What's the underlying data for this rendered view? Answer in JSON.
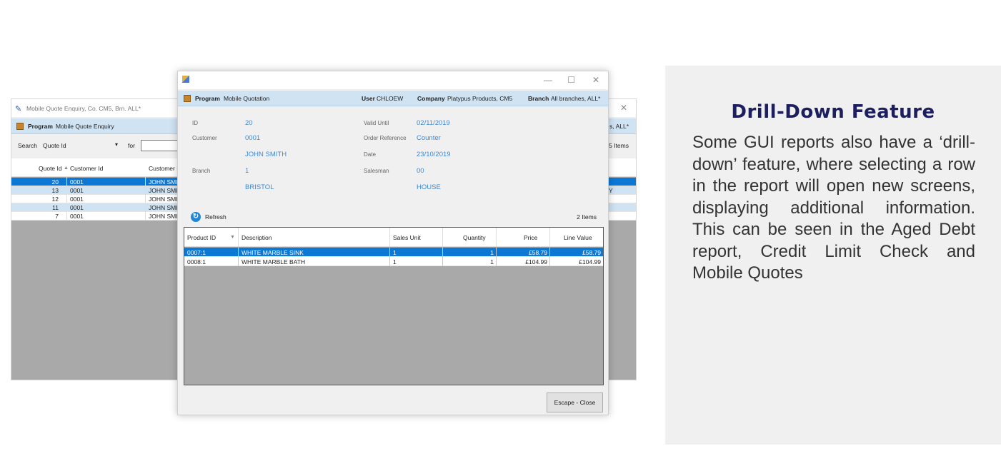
{
  "back_window": {
    "title": "Mobile Quote Enquiry, Co. CM5, Brn. ALL*",
    "program_label": "Program",
    "program_name": "Mobile Quote Enquiry",
    "branch_tail": "s, ALL*",
    "search_label": "Search",
    "search_field": "Quote Id",
    "for_label": "for",
    "items_count": "5 Items",
    "columns": [
      "Quote Id",
      "Customer Id",
      "Customer N"
    ],
    "rows": [
      {
        "quote_id": "20",
        "customer_id": "0001",
        "name": "JOHN SMI",
        "tail": ""
      },
      {
        "quote_id": "13",
        "customer_id": "0001",
        "name": "JOHN SMI",
        "tail": "Y"
      },
      {
        "quote_id": "12",
        "customer_id": "0001",
        "name": "JOHN SMI",
        "tail": ""
      },
      {
        "quote_id": "11",
        "customer_id": "0001",
        "name": "JOHN SMI",
        "tail": ""
      },
      {
        "quote_id": "7",
        "customer_id": "0001",
        "name": "JOHN SMI",
        "tail": ""
      }
    ]
  },
  "front_window": {
    "program_label": "Program",
    "program_name": "Mobile Quotation",
    "user_label": "User",
    "user_value": "CHLOEW",
    "company_label": "Company",
    "company_value": "Platypus Products, CM5",
    "branch_label": "Branch",
    "branch_value": "All branches, ALL*",
    "info": {
      "id_label": "ID",
      "id_value": "20",
      "customer_label": "Customer",
      "customer_code": "0001",
      "customer_name": "JOHN SMITH",
      "branch_label": "Branch",
      "branch_code": "1",
      "branch_name": "BRISTOL",
      "valid_until_label": "Valid Until",
      "valid_until_value": "02/11/2019",
      "order_ref_label": "Order Reference",
      "order_ref_value": "Counter",
      "date_label": "Date",
      "date_value": "23/10/2019",
      "salesman_label": "Salesman",
      "salesman_code": "00",
      "salesman_name": "HOUSE"
    },
    "refresh_label": "Refresh",
    "items_count": "2 Items",
    "columns": {
      "product_id": "Product ID",
      "description": "Description",
      "sales_unit": "Sales Unit",
      "quantity": "Quantity",
      "price": "Price",
      "line_value": "Line Value"
    },
    "rows": [
      {
        "product_id": "0007:1",
        "description": "WHITE MARBLE SINK",
        "sales_unit": "1",
        "quantity": "1",
        "price": "£58.79",
        "line_value": "£58.79"
      },
      {
        "product_id": "0008:1",
        "description": "WHITE MARBLE BATH",
        "sales_unit": "1",
        "quantity": "1",
        "price": "£104.99",
        "line_value": "£104.99"
      }
    ],
    "close_button": "Escape - Close"
  },
  "panel": {
    "heading": "Drill-Down Feature",
    "body": "Some GUI reports also have a ‘drill-down’ feature, where selecting a row in the report will open new screens, displaying additional information. This can be seen in the Aged Debt report, Credit Limit Check and Mobile Quotes"
  },
  "icons": [
    "app-icon",
    "close-icon",
    "program-icon",
    "chevron-down-icon",
    "sort-asc-icon",
    "sort-desc-icon",
    "refresh-icon",
    "minimize-icon",
    "maximize-icon"
  ],
  "colors": {
    "selected_row": "#0c78d4",
    "program_bar": "#cfe3f3",
    "value_text": "#3c8ad6",
    "heading": "#1c1e5e"
  }
}
